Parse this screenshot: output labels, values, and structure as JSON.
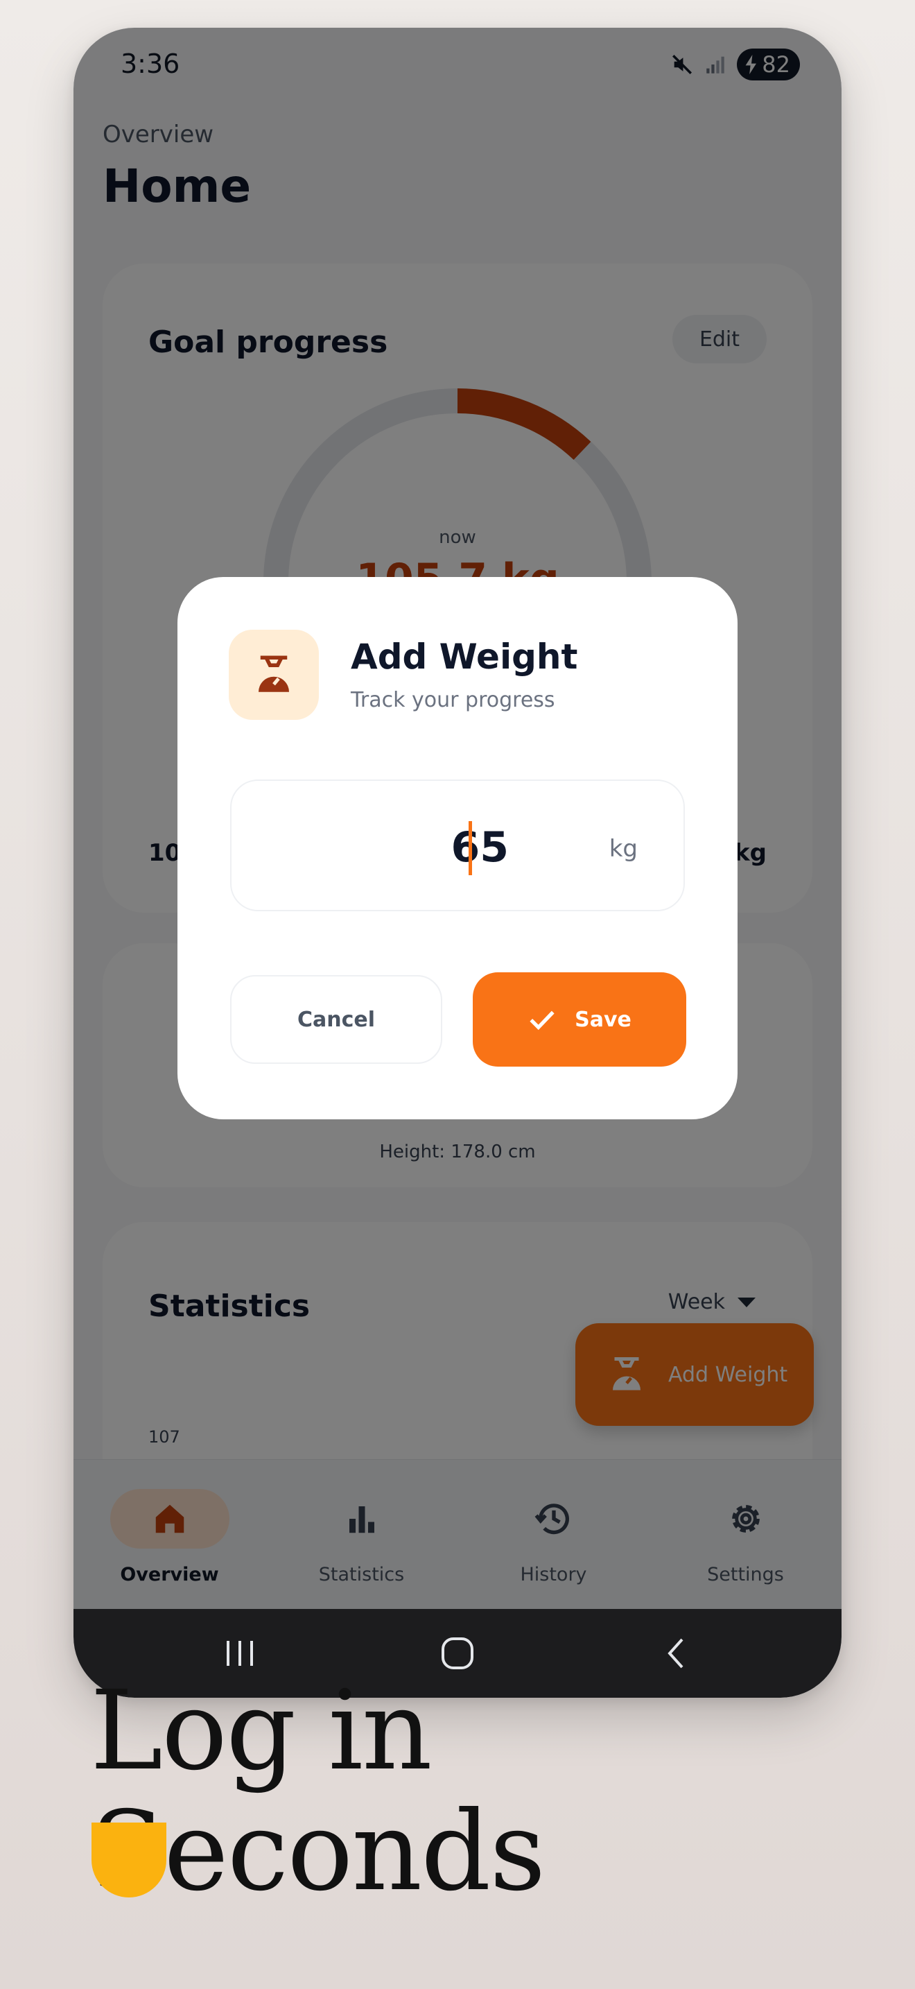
{
  "statusbar": {
    "time": "3:36",
    "battery": "82"
  },
  "header": {
    "section": "Overview",
    "title": "Home"
  },
  "goal_card": {
    "title": "Goal progress",
    "edit_label": "Edit",
    "now_label": "now",
    "current_weight": "105.7 kg",
    "start_label": "10",
    "goal_label": "kg"
  },
  "mid_card": {
    "height_text": "Height: 178.0 cm"
  },
  "stats_card": {
    "title": "Statistics",
    "period": "Week",
    "y_ticks": [
      "107",
      "107"
    ]
  },
  "fab": {
    "label": "Add Weight"
  },
  "nav": {
    "items": [
      {
        "label": "Overview",
        "icon": "home-icon"
      },
      {
        "label": "Statistics",
        "icon": "bar-chart-icon"
      },
      {
        "label": "History",
        "icon": "history-icon"
      },
      {
        "label": "Settings",
        "icon": "gear-icon"
      }
    ]
  },
  "dialog": {
    "title": "Add Weight",
    "subtitle": "Track your progress",
    "weight_value": "65",
    "unit": "kg",
    "cancel_label": "Cancel",
    "save_label": "Save"
  },
  "marketing": {
    "tagline": "Log in Seconds"
  },
  "colors": {
    "accent": "#f97316",
    "accent_dark": "#c2410c",
    "icon_bg": "#ffedd5",
    "highlight": "#fbb20f"
  }
}
